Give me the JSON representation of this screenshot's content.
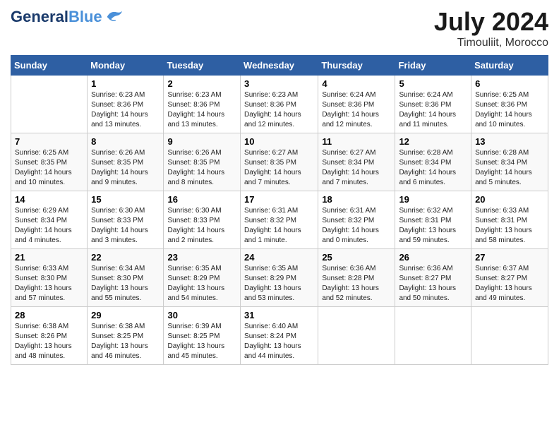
{
  "header": {
    "logo_line1": "General",
    "logo_line2": "Blue",
    "month": "July 2024",
    "location": "Timouliit, Morocco"
  },
  "columns": [
    "Sunday",
    "Monday",
    "Tuesday",
    "Wednesday",
    "Thursday",
    "Friday",
    "Saturday"
  ],
  "weeks": [
    [
      {
        "day": "",
        "info": ""
      },
      {
        "day": "1",
        "info": "Sunrise: 6:23 AM\nSunset: 8:36 PM\nDaylight: 14 hours\nand 13 minutes."
      },
      {
        "day": "2",
        "info": "Sunrise: 6:23 AM\nSunset: 8:36 PM\nDaylight: 14 hours\nand 13 minutes."
      },
      {
        "day": "3",
        "info": "Sunrise: 6:23 AM\nSunset: 8:36 PM\nDaylight: 14 hours\nand 12 minutes."
      },
      {
        "day": "4",
        "info": "Sunrise: 6:24 AM\nSunset: 8:36 PM\nDaylight: 14 hours\nand 12 minutes."
      },
      {
        "day": "5",
        "info": "Sunrise: 6:24 AM\nSunset: 8:36 PM\nDaylight: 14 hours\nand 11 minutes."
      },
      {
        "day": "6",
        "info": "Sunrise: 6:25 AM\nSunset: 8:36 PM\nDaylight: 14 hours\nand 10 minutes."
      }
    ],
    [
      {
        "day": "7",
        "info": "Sunrise: 6:25 AM\nSunset: 8:35 PM\nDaylight: 14 hours\nand 10 minutes."
      },
      {
        "day": "8",
        "info": "Sunrise: 6:26 AM\nSunset: 8:35 PM\nDaylight: 14 hours\nand 9 minutes."
      },
      {
        "day": "9",
        "info": "Sunrise: 6:26 AM\nSunset: 8:35 PM\nDaylight: 14 hours\nand 8 minutes."
      },
      {
        "day": "10",
        "info": "Sunrise: 6:27 AM\nSunset: 8:35 PM\nDaylight: 14 hours\nand 7 minutes."
      },
      {
        "day": "11",
        "info": "Sunrise: 6:27 AM\nSunset: 8:34 PM\nDaylight: 14 hours\nand 7 minutes."
      },
      {
        "day": "12",
        "info": "Sunrise: 6:28 AM\nSunset: 8:34 PM\nDaylight: 14 hours\nand 6 minutes."
      },
      {
        "day": "13",
        "info": "Sunrise: 6:28 AM\nSunset: 8:34 PM\nDaylight: 14 hours\nand 5 minutes."
      }
    ],
    [
      {
        "day": "14",
        "info": "Sunrise: 6:29 AM\nSunset: 8:34 PM\nDaylight: 14 hours\nand 4 minutes."
      },
      {
        "day": "15",
        "info": "Sunrise: 6:30 AM\nSunset: 8:33 PM\nDaylight: 14 hours\nand 3 minutes."
      },
      {
        "day": "16",
        "info": "Sunrise: 6:30 AM\nSunset: 8:33 PM\nDaylight: 14 hours\nand 2 minutes."
      },
      {
        "day": "17",
        "info": "Sunrise: 6:31 AM\nSunset: 8:32 PM\nDaylight: 14 hours\nand 1 minute."
      },
      {
        "day": "18",
        "info": "Sunrise: 6:31 AM\nSunset: 8:32 PM\nDaylight: 14 hours\nand 0 minutes."
      },
      {
        "day": "19",
        "info": "Sunrise: 6:32 AM\nSunset: 8:31 PM\nDaylight: 13 hours\nand 59 minutes."
      },
      {
        "day": "20",
        "info": "Sunrise: 6:33 AM\nSunset: 8:31 PM\nDaylight: 13 hours\nand 58 minutes."
      }
    ],
    [
      {
        "day": "21",
        "info": "Sunrise: 6:33 AM\nSunset: 8:30 PM\nDaylight: 13 hours\nand 57 minutes."
      },
      {
        "day": "22",
        "info": "Sunrise: 6:34 AM\nSunset: 8:30 PM\nDaylight: 13 hours\nand 55 minutes."
      },
      {
        "day": "23",
        "info": "Sunrise: 6:35 AM\nSunset: 8:29 PM\nDaylight: 13 hours\nand 54 minutes."
      },
      {
        "day": "24",
        "info": "Sunrise: 6:35 AM\nSunset: 8:29 PM\nDaylight: 13 hours\nand 53 minutes."
      },
      {
        "day": "25",
        "info": "Sunrise: 6:36 AM\nSunset: 8:28 PM\nDaylight: 13 hours\nand 52 minutes."
      },
      {
        "day": "26",
        "info": "Sunrise: 6:36 AM\nSunset: 8:27 PM\nDaylight: 13 hours\nand 50 minutes."
      },
      {
        "day": "27",
        "info": "Sunrise: 6:37 AM\nSunset: 8:27 PM\nDaylight: 13 hours\nand 49 minutes."
      }
    ],
    [
      {
        "day": "28",
        "info": "Sunrise: 6:38 AM\nSunset: 8:26 PM\nDaylight: 13 hours\nand 48 minutes."
      },
      {
        "day": "29",
        "info": "Sunrise: 6:38 AM\nSunset: 8:25 PM\nDaylight: 13 hours\nand 46 minutes."
      },
      {
        "day": "30",
        "info": "Sunrise: 6:39 AM\nSunset: 8:25 PM\nDaylight: 13 hours\nand 45 minutes."
      },
      {
        "day": "31",
        "info": "Sunrise: 6:40 AM\nSunset: 8:24 PM\nDaylight: 13 hours\nand 44 minutes."
      },
      {
        "day": "",
        "info": ""
      },
      {
        "day": "",
        "info": ""
      },
      {
        "day": "",
        "info": ""
      }
    ]
  ]
}
